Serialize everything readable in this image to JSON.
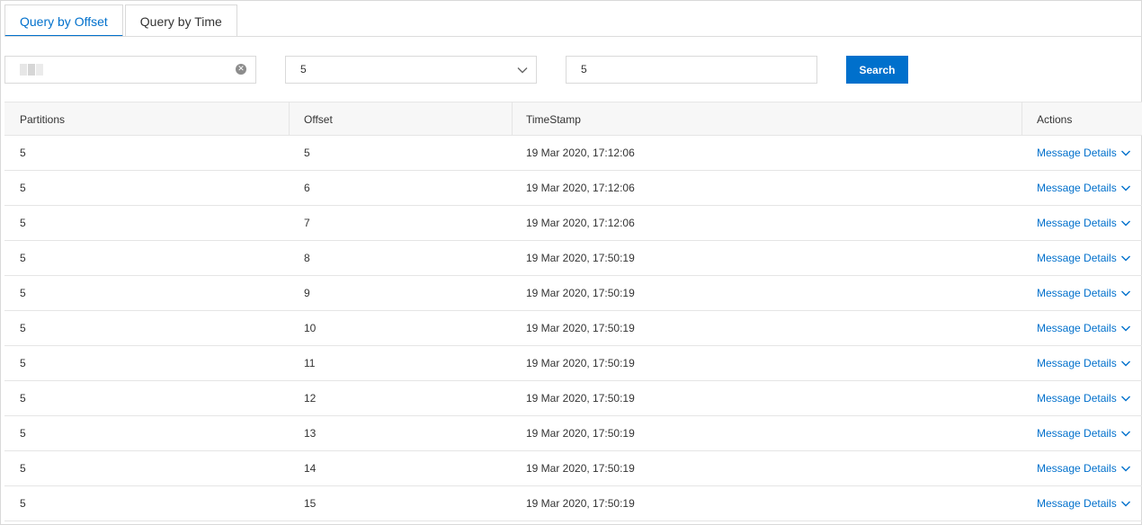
{
  "tabs": [
    {
      "label": "Query by Offset",
      "active": true
    },
    {
      "label": "Query by Time",
      "active": false
    }
  ],
  "filters": {
    "partition_value": "5",
    "offset_value": "5",
    "search_label": "Search"
  },
  "table": {
    "headers": [
      "Partitions",
      "Offset",
      "TimeStamp",
      "Actions"
    ],
    "action_label": "Message Details",
    "rows": [
      {
        "partition": "5",
        "offset": "5",
        "timestamp": "19 Mar 2020, 17:12:06"
      },
      {
        "partition": "5",
        "offset": "6",
        "timestamp": "19 Mar 2020, 17:12:06"
      },
      {
        "partition": "5",
        "offset": "7",
        "timestamp": "19 Mar 2020, 17:12:06"
      },
      {
        "partition": "5",
        "offset": "8",
        "timestamp": "19 Mar 2020, 17:50:19"
      },
      {
        "partition": "5",
        "offset": "9",
        "timestamp": "19 Mar 2020, 17:50:19"
      },
      {
        "partition": "5",
        "offset": "10",
        "timestamp": "19 Mar 2020, 17:50:19"
      },
      {
        "partition": "5",
        "offset": "11",
        "timestamp": "19 Mar 2020, 17:50:19"
      },
      {
        "partition": "5",
        "offset": "12",
        "timestamp": "19 Mar 2020, 17:50:19"
      },
      {
        "partition": "5",
        "offset": "13",
        "timestamp": "19 Mar 2020, 17:50:19"
      },
      {
        "partition": "5",
        "offset": "14",
        "timestamp": "19 Mar 2020, 17:50:19"
      },
      {
        "partition": "5",
        "offset": "15",
        "timestamp": "19 Mar 2020, 17:50:19"
      }
    ]
  },
  "icons": {
    "clear": "close-circle-icon",
    "dropdown": "chevron-down-icon",
    "expand": "chevron-down-icon"
  },
  "colors": {
    "accent": "#0070cc",
    "border": "#d9d9d9",
    "header_bg": "#f7f7f7"
  }
}
